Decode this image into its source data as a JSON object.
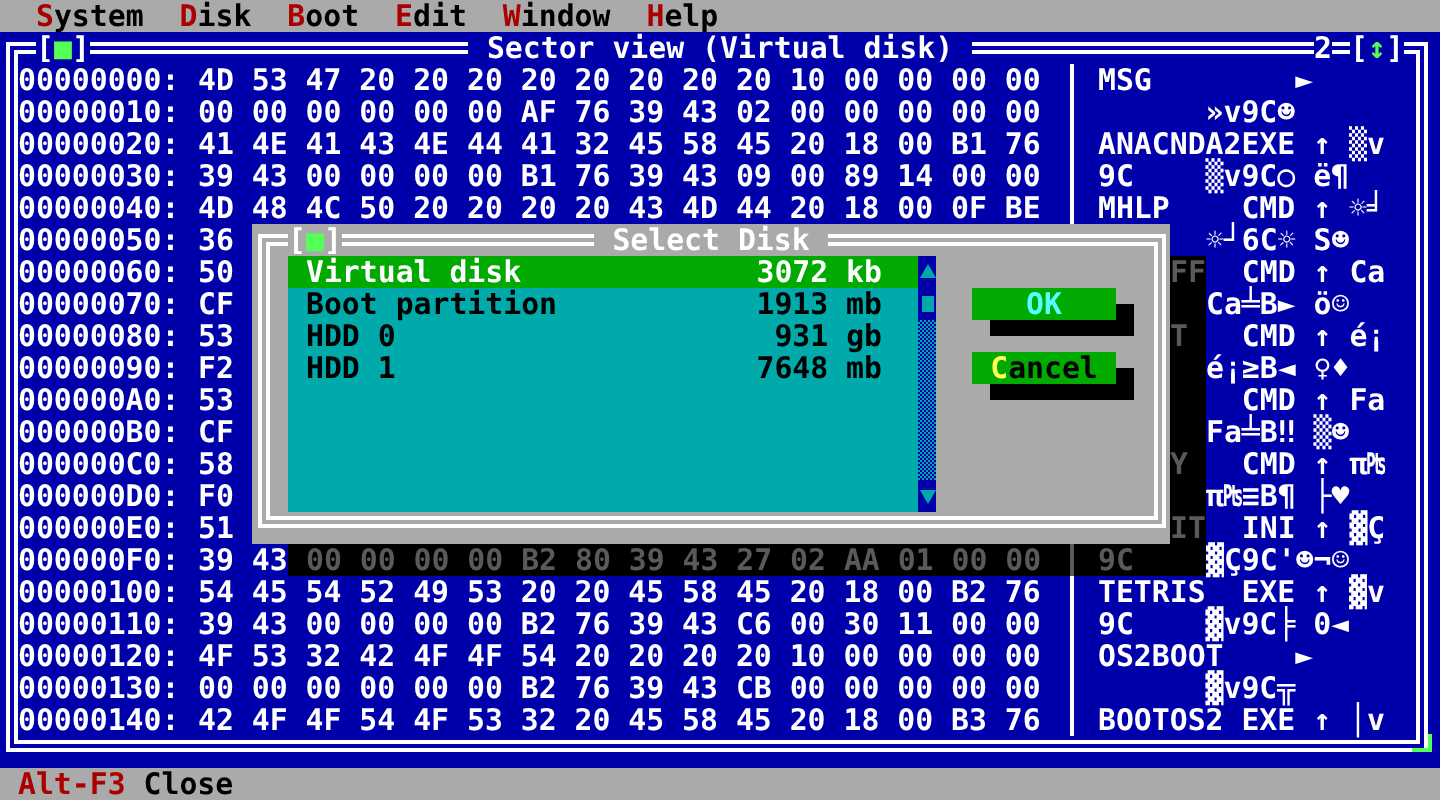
{
  "menu": [
    {
      "hotkey": "S",
      "rest": "ystem"
    },
    {
      "hotkey": "D",
      "rest": "isk"
    },
    {
      "hotkey": "B",
      "rest": "oot"
    },
    {
      "hotkey": "E",
      "rest": "dit"
    },
    {
      "hotkey": "W",
      "rest": "indow"
    },
    {
      "hotkey": "H",
      "rest": "elp"
    }
  ],
  "window": {
    "title": "Sector view (Virtual disk)",
    "close_glyph": "[■]",
    "number": "2",
    "zoom_glyph": "[↕]"
  },
  "rows": [
    {
      "kind": "full",
      "address": "00000000:",
      "hex": "4D 53 47 20 20 20 20 20 20 20 20 10 00 00 00 00",
      "ascii": "MSG        ►"
    },
    {
      "kind": "full",
      "address": "00000010:",
      "hex": "00 00 00 00 00 00 AF 76 39 43 02 00 00 00 00 00",
      "ascii": "      »v9C☻"
    },
    {
      "kind": "full",
      "address": "00000020:",
      "hex": "41 4E 41 43 4E 44 41 32 45 58 45 20 18 00 B1 76",
      "ascii": "ANACNDA2EXE ↑ ▒v"
    },
    {
      "kind": "full",
      "address": "00000030:",
      "hex": "39 43 00 00 00 00 B1 76 39 43 09 00 89 14 00 00",
      "ascii": "9C    ▒v9C○ ë¶"
    },
    {
      "kind": "full",
      "address": "00000040:",
      "hex": "4D 48 4C 50 20 20 20 20 43 4D 44 20 18 00 0F BE",
      "ascii": "MHLP    CMD ↑ ☼╛"
    },
    {
      "kind": "covered",
      "address": "00000050:",
      "hex": "36",
      "ascii_tail": "☼┘6C☼ S☻"
    },
    {
      "kind": "covered",
      "address": "00000060:",
      "hex": "50",
      "shadow_text": "FF",
      "ascii_tail": "  CMD ↑ Ca"
    },
    {
      "kind": "covered",
      "address": "00000070:",
      "hex": "CF",
      "ascii_tail": "Ca╧B► ö☺"
    },
    {
      "kind": "covered",
      "address": "00000080:",
      "hex": "53",
      "shadow_text": "T",
      "ascii_tail": "  CMD ↑ é¡"
    },
    {
      "kind": "covered",
      "address": "00000090:",
      "hex": "F2",
      "ascii_tail": "é¡≥B◄ ♀♦"
    },
    {
      "kind": "covered",
      "address": "000000A0:",
      "hex": "53",
      "ascii_tail": "  CMD ↑ Fa"
    },
    {
      "kind": "covered",
      "address": "000000B0:",
      "hex": "CF",
      "ascii_tail": "Fa╧B‼ ▒☻"
    },
    {
      "kind": "covered",
      "address": "000000C0:",
      "hex": "58",
      "shadow_text": "Y",
      "ascii_tail": "  CMD ↑ π₧"
    },
    {
      "kind": "covered",
      "address": "000000D0:",
      "hex": "F0",
      "ascii_tail": "π₧≡B¶ ├♥"
    },
    {
      "kind": "covered",
      "address": "000000E0:",
      "hex": "51",
      "shadow_text": "IT",
      "ascii_tail": "  INI ↑ ▓Ç"
    },
    {
      "kind": "shadowed",
      "address": "000000F0:",
      "hex": "39 43",
      "shadow_hex": "00 00 00 00 B2 80 39 43 27 02 AA 01 00 00",
      "shadow_ascii": "9C",
      "ascii_tail": "▓Ç9C'☻¬☺"
    },
    {
      "kind": "full",
      "address": "00000100:",
      "hex": "54 45 54 52 49 53 20 20 45 58 45 20 18 00 B2 76",
      "ascii": "TETRIS  EXE ↑ ▓v"
    },
    {
      "kind": "full",
      "address": "00000110:",
      "hex": "39 43 00 00 00 00 B2 76 39 43 C6 00 30 11 00 00",
      "ascii": "9C    ▓v9C╞ 0◄"
    },
    {
      "kind": "full",
      "address": "00000120:",
      "hex": "4F 53 32 42 4F 4F 54 20 20 20 20 10 00 00 00 00",
      "ascii": "OS2BOOT    ►"
    },
    {
      "kind": "full",
      "address": "00000130:",
      "hex": "00 00 00 00 00 00 B2 76 39 43 CB 00 00 00 00 00",
      "ascii": "      ▓v9C╦"
    },
    {
      "kind": "full",
      "address": "00000140:",
      "hex": "42 4F 4F 54 4F 53 32 20 45 58 45 20 18 00 B3 76",
      "ascii": "BOOTOS2 EXE ↑ │v"
    }
  ],
  "dialog": {
    "title": "Select Disk",
    "close_glyph": "[■]",
    "disks": [
      {
        "name": "Virtual disk",
        "size": "3072 kb",
        "selected": true
      },
      {
        "name": "Boot partition",
        "size": "1913 mb",
        "selected": false
      },
      {
        "name": "HDD 0",
        "size": "931 gb",
        "selected": false
      },
      {
        "name": "HDD 1",
        "size": "7648 mb",
        "selected": false
      }
    ],
    "buttons": [
      {
        "label": "OK",
        "default": true
      },
      {
        "hotkey": "C",
        "rest": "ancel",
        "default": false
      }
    ]
  },
  "status_bar": [
    {
      "key": "Alt-F3",
      "label": "Close"
    }
  ]
}
